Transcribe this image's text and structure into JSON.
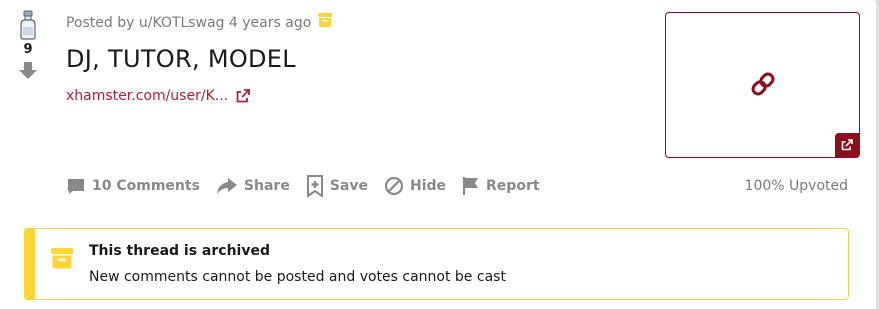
{
  "post": {
    "score": "9",
    "posted_by": "Posted by u/KOTLswag 4 years ago",
    "title": "DJ, TUTOR, MODEL",
    "link_text": "xhamster.com/user/K...",
    "upvoted": "100% Upvoted"
  },
  "actions": {
    "comments": "10 Comments",
    "share": "Share",
    "save": "Save",
    "hide": "Hide",
    "report": "Report"
  },
  "banner": {
    "title": "This thread is archived",
    "text": "New comments cannot be posted and votes cannot be cast"
  },
  "colors": {
    "link": "#b51f36",
    "thumb_border": "#8c0f1e",
    "archive_yellow": "#ffd635",
    "muted": "#878a8c"
  },
  "icons": [
    "award-bottle-icon",
    "downvote-arrow-icon",
    "archive-box-icon",
    "external-link-icon",
    "chain-link-icon",
    "comment-icon",
    "share-icon",
    "save-icon",
    "hide-icon",
    "report-flag-icon"
  ]
}
